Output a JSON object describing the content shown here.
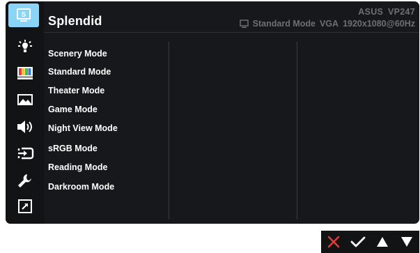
{
  "header": {
    "title": "Splendid",
    "model": "ASUS  VP247",
    "status_mode": "Standard Mode",
    "status_input": "VGA",
    "status_resolution": "1920x1080@60Hz"
  },
  "sidebar": {
    "items": [
      {
        "icon": "splendid-icon",
        "active": true,
        "glyph": "S"
      },
      {
        "icon": "brightness-icon"
      },
      {
        "icon": "color-icon"
      },
      {
        "icon": "image-icon"
      },
      {
        "icon": "sound-icon"
      },
      {
        "icon": "input-select-icon"
      },
      {
        "icon": "system-setup-icon"
      },
      {
        "icon": "shortcut-icon"
      }
    ]
  },
  "modes": [
    "Scenery Mode",
    "Standard Mode",
    "Theater Mode",
    "Game Mode",
    "Night View Mode",
    "sRGB Mode",
    "Reading Mode",
    "Darkroom Mode"
  ],
  "colors": {
    "osd_bg": "#17181b",
    "accent": "#8ad4f7",
    "close": "#e23b3b",
    "dim_text": "#6c6f74"
  }
}
